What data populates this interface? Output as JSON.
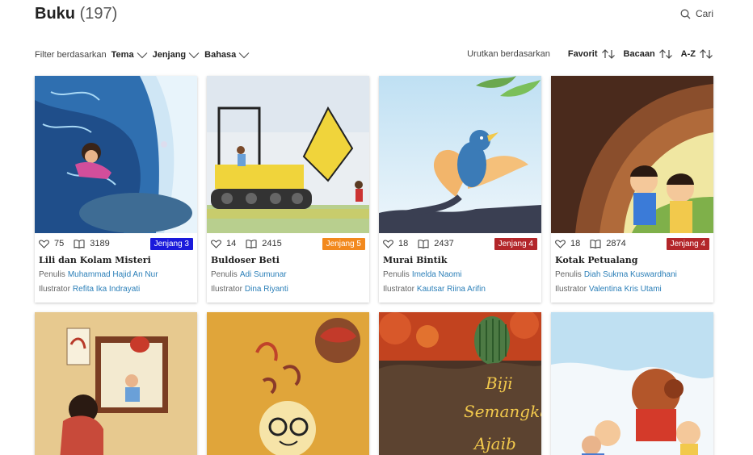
{
  "header": {
    "title": "Buku",
    "count": "(197)",
    "search_label": "Cari",
    "search_icon": "search-icon"
  },
  "filter": {
    "label": "Filter berdasarkan",
    "items": [
      "Tema",
      "Jenjang",
      "Bahasa"
    ]
  },
  "sort": {
    "label": "Urutkan berdasarkan",
    "items": [
      "Favorit",
      "Bacaan",
      "A-Z"
    ]
  },
  "labels": {
    "writer": "Penulis",
    "illustrator": "Ilustrator"
  },
  "books": [
    {
      "title": "Lili dan Kolam Misteri",
      "likes": "75",
      "reads": "3189",
      "level": "Jenjang 3",
      "level_color": "#1a1adb",
      "writer": "Muhammad Hajid An Nur",
      "illustrator": "Refita Ika Indrayati"
    },
    {
      "title": "Buldoser Beti",
      "likes": "14",
      "reads": "2415",
      "level": "Jenjang 5",
      "level_color": "#f2891e",
      "writer": "Adi Sumunar",
      "illustrator": "Dina Riyanti"
    },
    {
      "title": "Murai Bintik",
      "likes": "18",
      "reads": "2437",
      "level": "Jenjang 4",
      "level_color": "#b3262a",
      "writer": "Imelda Naomi",
      "illustrator": "Kautsar Riina Arifin"
    },
    {
      "title": "Kotak Petualang",
      "likes": "18",
      "reads": "2874",
      "level": "Jenjang 4",
      "level_color": "#b3262a",
      "writer": "Diah Sukma Kuswardhani",
      "illustrator": "Valentina Kris Utami"
    }
  ],
  "second_row_covers": [
    {
      "cover_text": ""
    },
    {
      "cover_text": ""
    },
    {
      "cover_text_1": "Biji",
      "cover_text_2": "Semangka",
      "cover_text_3": "Ajaib"
    },
    {
      "cover_text": ""
    }
  ]
}
